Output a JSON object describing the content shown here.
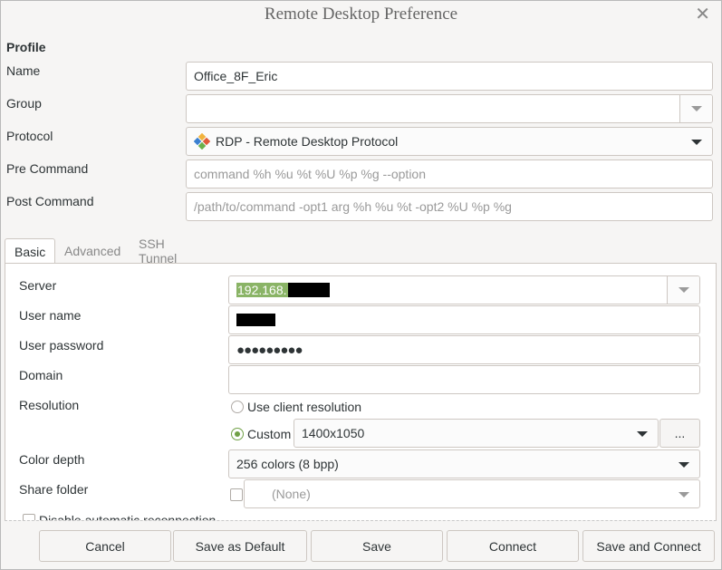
{
  "window": {
    "title": "Remote Desktop Preference",
    "close_glyph": "✕"
  },
  "profile": {
    "section_title": "Profile",
    "name_label": "Name",
    "name_value": "Office_8F_Eric",
    "group_label": "Group",
    "group_value": "",
    "protocol_label": "Protocol",
    "protocol_value": "RDP - Remote Desktop Protocol",
    "protocol_icon": "rdp-plugin-icon",
    "precommand_label": "Pre Command",
    "precommand_placeholder": "command %h %u %t %U %p %g --option",
    "postcommand_label": "Post Command",
    "postcommand_placeholder": "/path/to/command -opt1 arg %h %u %t -opt2 %U %p %g"
  },
  "tabs": [
    {
      "label": "Basic",
      "active": true
    },
    {
      "label": "Advanced",
      "active": false
    },
    {
      "label": "SSH Tunnel",
      "active": false
    }
  ],
  "basic": {
    "server_label": "Server",
    "server_value": "192.168.",
    "username_label": "User name",
    "password_label": "User password",
    "password_mask": "●●●●●●●●●",
    "domain_label": "Domain",
    "domain_value": "",
    "resolution_label": "Resolution",
    "resolution_client": "Use client resolution",
    "resolution_custom": "Custom",
    "resolution_value": "1400x1050",
    "resolution_more": "...",
    "colordepth_label": "Color depth",
    "colordepth_value": "256 colors (8 bpp)",
    "sharefolder_label": "Share folder",
    "sharefolder_value": "(None)",
    "partial_option": "Disable automatic reconnection"
  },
  "buttons": {
    "cancel": "Cancel",
    "save_default": "Save as Default",
    "save": "Save",
    "connect": "Connect",
    "save_connect": "Save and Connect"
  },
  "colors": {
    "selection": "#8ab466",
    "radio_on": "#70a046"
  }
}
